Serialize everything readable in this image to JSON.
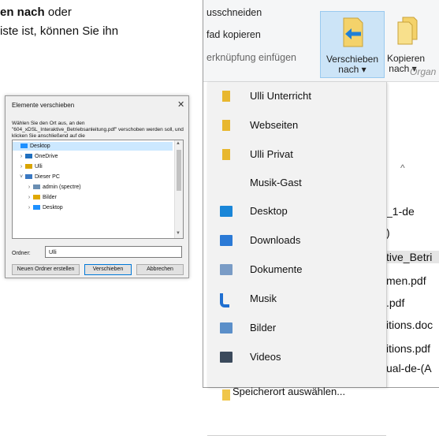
{
  "page_text": {
    "line1_bold": "en nach",
    "line1_rest": " oder",
    "line2": "iste ist, können Sie ihn"
  },
  "dialog": {
    "title": "Elemente verschieben",
    "close": "✕",
    "description": "Wählen Sie den Ort aus, an den \"604_xDSL_Interaktive_Betriebsanleitung.pdf\" verschoben werden soll, und klicken Sie anschließend auf die",
    "tree": [
      {
        "label": "Desktop",
        "chevron": "",
        "icon": "desktop-icon",
        "color": "#1e90ff"
      },
      {
        "label": "OneDrive",
        "chevron": "›",
        "icon": "onedrive-icon",
        "color": "#1f6fbf"
      },
      {
        "label": "Ulli",
        "chevron": "›",
        "icon": "user-folder-icon",
        "color": "#d9a400"
      },
      {
        "label": "Dieser PC",
        "chevron": "˅",
        "icon": "pc-icon",
        "color": "#3a78c2"
      },
      {
        "label": "admin (spectre)",
        "chevron": "›",
        "icon": "network-drive-icon",
        "color": "#6b8fb3"
      },
      {
        "label": "Bilder",
        "chevron": "›",
        "icon": "pictures-icon",
        "color": "#e0a800"
      },
      {
        "label": "Desktop",
        "chevron": "›",
        "icon": "desktop-icon",
        "color": "#1e90ff"
      }
    ],
    "ordner_label": "Ordner:",
    "ordner_value": "Ulli",
    "buttons": {
      "new_folder": "Neuen Ordner erstellen",
      "move": "Verschieben",
      "cancel": "Abbrechen"
    }
  },
  "ribbon": {
    "cut": "usschneiden",
    "copy_path": "fad kopieren",
    "paste_shortcut": "erknüpfung einfügen",
    "move_to": "Verschieben",
    "move_to_2": "nach",
    "copy_to": "Kopieren",
    "copy_to_2": "nach",
    "organize": "Organ",
    "arrow": "▾",
    "collapse_chevron": "^"
  },
  "dropdown": {
    "items": [
      {
        "label": "Ulli Unterricht",
        "icon": "folder-icon",
        "color": "#e8b72e"
      },
      {
        "label": "Webseiten",
        "icon": "folder-icon",
        "color": "#e8b72e"
      },
      {
        "label": "Ulli Privat",
        "icon": "folder-icon",
        "color": "#e8b72e"
      },
      {
        "label": "Musik-Gast",
        "icon": "",
        "color": ""
      },
      {
        "label": "Desktop",
        "icon": "desktop-icon",
        "color": "#1a86d8"
      },
      {
        "label": "Downloads",
        "icon": "downloads-icon",
        "color": "#2b7ad6"
      },
      {
        "label": "Dokumente",
        "icon": "documents-icon",
        "color": "#7a9cc6"
      },
      {
        "label": "Musik",
        "icon": "music-icon",
        "color": "#1f6fd1"
      },
      {
        "label": "Bilder",
        "icon": "pictures-icon",
        "color": "#5b8fc9"
      },
      {
        "label": "Videos",
        "icon": "videos-icon",
        "color": "#3b4a5c"
      },
      {
        "label": "Speicherort auswählen...",
        "icon": "folder-icon",
        "color": "#f0c64a"
      }
    ]
  },
  "background_files": [
    "_1-de",
    ")",
    "tive_Betri",
    "men.pdf",
    ".pdf",
    "itions.doc",
    "itions.pdf",
    "ual-de-(A"
  ]
}
